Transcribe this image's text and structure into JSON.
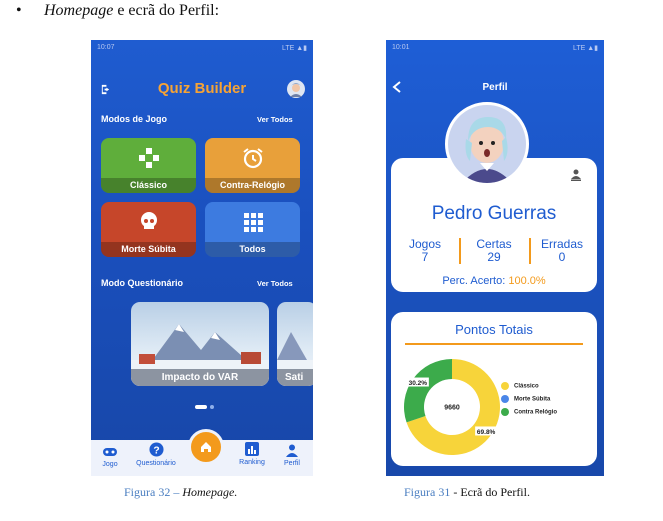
{
  "doc": {
    "bullet": "•",
    "line_italic": "Homepage",
    "line_rest": " e ecrã do Perfil:"
  },
  "homepage": {
    "status_time": "10:07",
    "status_right": "LTE ▲▮",
    "title": "Quiz Builder",
    "modes_label": "Modos de Jogo",
    "modes_link": "Ver Todos",
    "tiles": [
      {
        "label": "Clássico",
        "color": "#5fae3b",
        "icon": "gamepad-icon"
      },
      {
        "label": "Contra-Relógio",
        "color": "#e8a03a",
        "icon": "alarm-clock-icon"
      },
      {
        "label": "Morte Súbita",
        "color": "#c6462a",
        "icon": "skull-icon"
      },
      {
        "label": "Todos",
        "color": "#3d7be0",
        "icon": "grid-icon"
      }
    ],
    "quiz_label": "Modo Questionário",
    "quiz_link": "Ver Todos",
    "quiz_cards": [
      {
        "label": "Impacto do VAR"
      },
      {
        "label": "Sati"
      }
    ],
    "nav": {
      "jogo": "Jogo",
      "questionario": "Questionário",
      "ranking": "Ranking",
      "perfil": "Perfil"
    }
  },
  "profile": {
    "status_time": "10:01",
    "status_right": "LTE ▲▮",
    "title": "Perfil",
    "name": "Pedro Guerras",
    "stats": [
      {
        "label": "Jogos",
        "value": "7"
      },
      {
        "label": "Certas",
        "value": "29"
      },
      {
        "label": "Erradas",
        "value": "0"
      }
    ],
    "perc_label": "Perc. Acerto:",
    "perc_value": "100.0%",
    "points_title": "Pontos Totais"
  },
  "chart_data": {
    "type": "pie",
    "center_label": "9660",
    "slices": [
      {
        "name": "Clássico",
        "percent": 69.8,
        "label": "69.8%",
        "color": "#f7d43a"
      },
      {
        "name": "Morte Súbita",
        "percent": 0.0,
        "label": "",
        "color": "#4a86e8"
      },
      {
        "name": "Contra Relógio",
        "percent": 30.2,
        "label": "30.2%",
        "color": "#3cab4b"
      }
    ],
    "legend": "right"
  },
  "captions": {
    "left_prefix": "Figura 32 – ",
    "left_italic": "Homepage.",
    "right_prefix": "Figura 31",
    "right_rest": " - Ecrã do Perfil."
  }
}
